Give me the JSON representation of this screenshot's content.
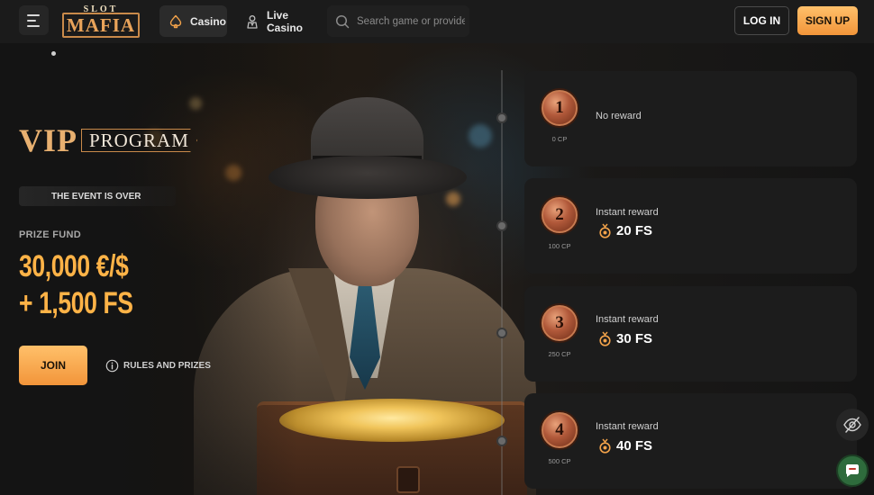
{
  "header": {
    "logo_top": "SLOT",
    "logo_main": "MAFIA",
    "tabs": [
      {
        "label": "Casino",
        "icon": "spade-icon"
      },
      {
        "label": "Live Casino",
        "icon": "dealer-icon"
      }
    ],
    "search": {
      "placeholder": "Search game or provider",
      "icon": "search-icon"
    },
    "login_label": "LOG IN",
    "signup_label": "SIGN UP"
  },
  "promo": {
    "title_vip": "VIP",
    "title_program": "PROGRAM",
    "status": "THE EVENT IS OVER",
    "prize_label": "PRIZE FUND",
    "prize_line1": "30,000 €/$",
    "prize_line2": "+ 1,500 FS",
    "join_label": "JOIN",
    "rules_label": "RULES AND PRIZES"
  },
  "levels": [
    {
      "number": "1",
      "cp": "0 CP",
      "label": "No reward",
      "value": ""
    },
    {
      "number": "2",
      "cp": "100 CP",
      "label": "Instant reward",
      "value": "20 FS"
    },
    {
      "number": "3",
      "cp": "250 CP",
      "label": "Instant reward",
      "value": "30 FS"
    },
    {
      "number": "4",
      "cp": "500 CP",
      "label": "Instant reward",
      "value": "40 FS"
    }
  ],
  "colors": {
    "accent": "#f7a94a",
    "header_bg": "#1b1b1b",
    "card_bg": "#1c1c1c",
    "medal": "#b1593a"
  }
}
